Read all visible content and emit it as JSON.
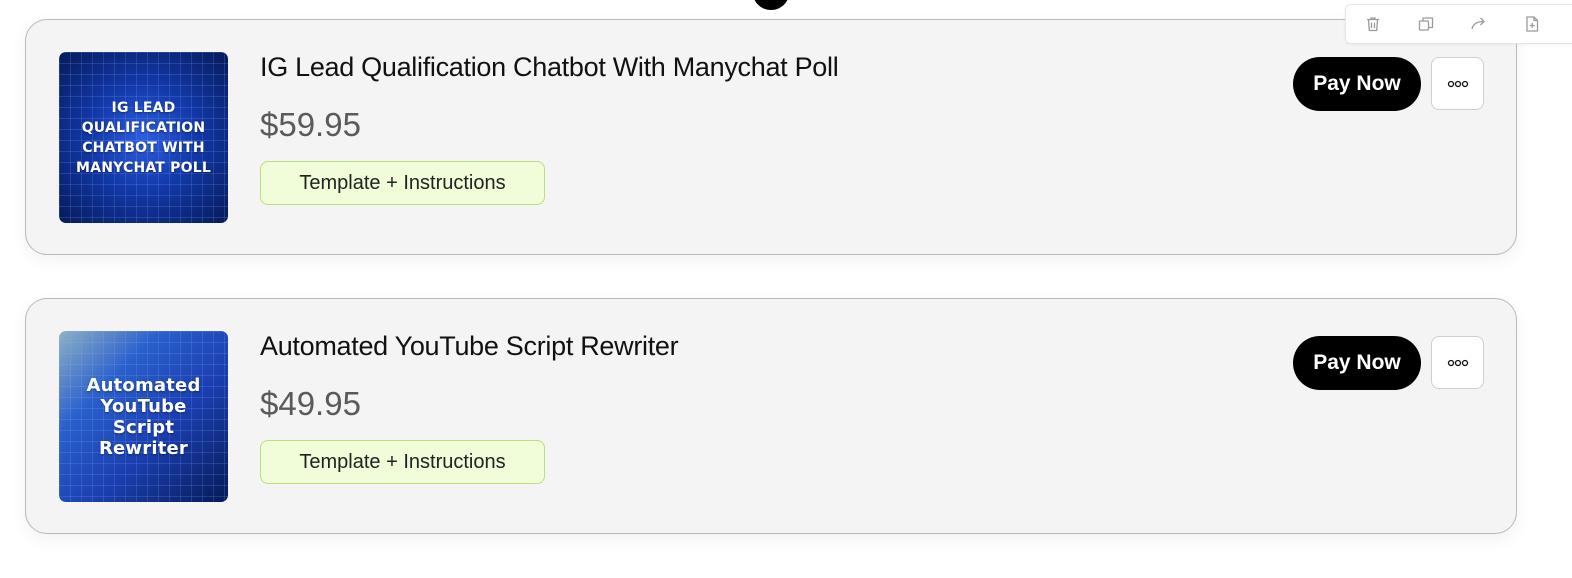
{
  "toolbar": {
    "icons": [
      "trash-icon",
      "duplicate-icon",
      "forward-icon",
      "add-page-icon"
    ]
  },
  "products": [
    {
      "thumbnail_text": "IG LEAD QUALIFICATION CHATBOT WITH MANYCHAT POLL",
      "title": "IG Lead Qualification Chatbot With Manychat Poll",
      "price": "$59.95",
      "tag": "Template + Instructions",
      "pay_label": "Pay Now"
    },
    {
      "thumbnail_text": "Automated YouTube Script Rewriter",
      "title": "Automated YouTube Script Rewriter",
      "price": "$49.95",
      "tag": "Template + Instructions",
      "pay_label": "Pay Now"
    }
  ],
  "colors": {
    "card_bg": "#f4f4f4",
    "tag_bg": "#f0fdd8",
    "tag_border": "#b8e07c",
    "button_bg": "#000000",
    "thumbnail_blue": "#1238a8"
  }
}
